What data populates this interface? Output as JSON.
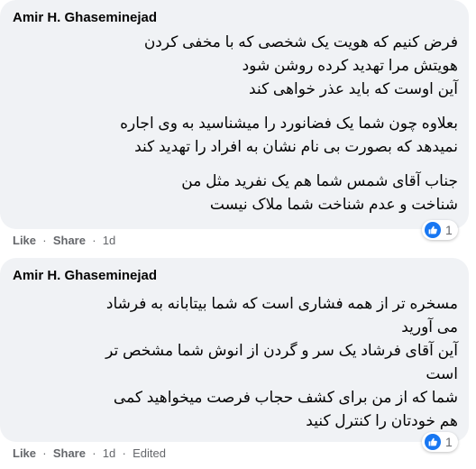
{
  "comments": [
    {
      "author": "Amir H. Ghaseminejad",
      "paragraphs": [
        [
          "فرض کنیم که هویت یک شخصی که با مخفی کردن",
          "هویتش مرا تهدید کرده روشن شود",
          "آین اوست که باید عذر خواهی کند"
        ],
        [
          "بعلاوه چون شما یک فضانورد را میشناسید به وی اجاره",
          "نمیدهد که بصورت بی نام نشان به افراد را تهدید کند"
        ],
        [
          "جناب آقای شمس شما هم یک نفرید مثل من",
          "شناخت و عدم شناخت شما ملاک نیست"
        ]
      ],
      "actions": {
        "like": "Like",
        "share": "Share",
        "time": "1d",
        "edited": ""
      },
      "reaction": {
        "icon": "like-icon",
        "count": "1"
      }
    },
    {
      "author": "Amir H. Ghaseminejad",
      "paragraphs": [
        [
          "مسخره تر از همه فشاری است که شما بیتابانه به فرشاد",
          "می آورید",
          "آین آقای فرشاد یک سر و گردن از انوش شما مشخص تر",
          "است",
          "شما که از من برای کشف حجاب فرصت میخواهید کمی",
          "هم خودتان را کنترل کنید"
        ]
      ],
      "actions": {
        "like": "Like",
        "share": "Share",
        "time": "1d",
        "edited": "Edited"
      },
      "reaction": {
        "icon": "like-icon",
        "count": "1"
      }
    }
  ],
  "colors": {
    "bubble": "#f0f2f5",
    "meta": "#65676b",
    "like": "#1877f2"
  }
}
